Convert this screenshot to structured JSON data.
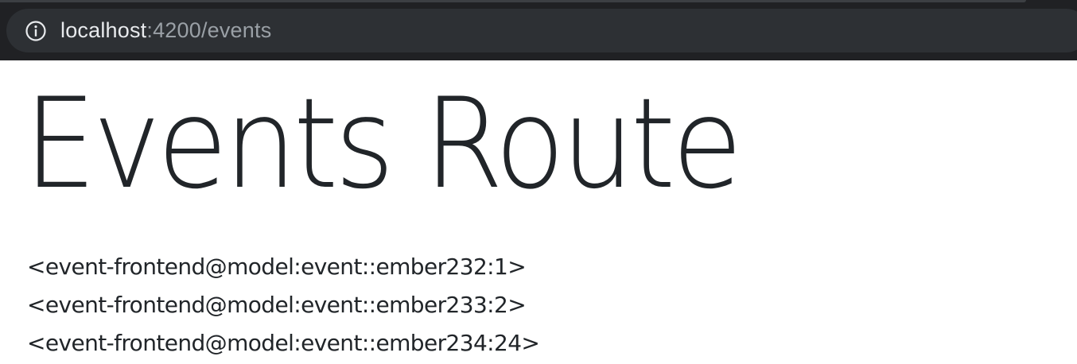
{
  "browser": {
    "address_bar": {
      "host": "localhost",
      "path": ":4200/events"
    },
    "icons": {
      "site_info": "info-icon"
    }
  },
  "page": {
    "title": "Events Route",
    "records": [
      "<event-frontend@model:event::ember232:1>",
      "<event-frontend@model:event::ember233:2>",
      "<event-frontend@model:event::ember234:24>"
    ]
  },
  "colors": {
    "chrome_bg": "#202124",
    "omnibox_bg": "#2d3034",
    "url_host": "#e8eaed",
    "url_path": "#9aa0a6",
    "text": "#212529",
    "page_bg": "#ffffff"
  }
}
